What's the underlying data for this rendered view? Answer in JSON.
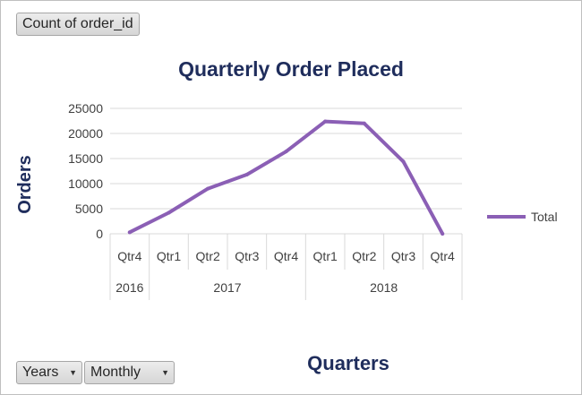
{
  "pivot": {
    "value_field": "Count of order_id",
    "filters": [
      "Years",
      "Monthly"
    ]
  },
  "chart_data": {
    "type": "line",
    "title": "Quarterly Order Placed",
    "xlabel": "Quarters",
    "ylabel": "Orders",
    "ylim": [
      0,
      25000
    ],
    "yticks": [
      0,
      5000,
      10000,
      15000,
      20000,
      25000
    ],
    "grid": true,
    "legend": "right",
    "categories": [
      {
        "year": "2016",
        "quarter": "Qtr4"
      },
      {
        "year": "2017",
        "quarter": "Qtr1"
      },
      {
        "year": "2017",
        "quarter": "Qtr2"
      },
      {
        "year": "2017",
        "quarter": "Qtr3"
      },
      {
        "year": "2017",
        "quarter": "Qtr4"
      },
      {
        "year": "2018",
        "quarter": "Qtr1"
      },
      {
        "year": "2018",
        "quarter": "Qtr2"
      },
      {
        "year": "2018",
        "quarter": "Qtr3"
      },
      {
        "year": "2018",
        "quarter": "Qtr4"
      }
    ],
    "years": [
      "2016",
      "2017",
      "2018"
    ],
    "series": [
      {
        "name": "Total",
        "color": "#8b5fb5",
        "values": [
          300,
          4200,
          9000,
          11800,
          16400,
          22400,
          22000,
          14400,
          0
        ]
      }
    ]
  }
}
